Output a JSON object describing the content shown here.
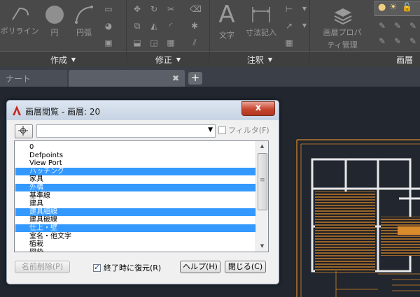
{
  "ribbon": {
    "panels": [
      {
        "footer": "作成",
        "tools": [
          "ポリライン",
          "円",
          "円弧"
        ]
      },
      {
        "footer": "修正"
      },
      {
        "footer": "注釈",
        "tools": [
          "文字",
          "寸法記入"
        ]
      },
      {
        "footer": "画層",
        "tools": [
          "画層プロパティ管理"
        ]
      }
    ]
  },
  "tabs": {
    "start_label": "ナート",
    "close_icon": "close-icon",
    "add_label": "+"
  },
  "dialog": {
    "title": "画層閲覧 - 画層: 20",
    "close_label": "x",
    "combo_value": "",
    "filter_label": "フィルタ(F)",
    "layers": [
      "0",
      "Defpoints",
      "View Port",
      "ハッチング",
      "家具",
      "外構",
      "基準線",
      "建具",
      "建具細線",
      "建具破線",
      "仕上・壁",
      "室名・他文字",
      "植栽",
      "図枠"
    ],
    "selected_layers": [
      "ハッチング",
      "外構",
      "建具細線",
      "仕上・壁"
    ],
    "buttons": {
      "delete_name": "名前削除(P)",
      "restore_on_exit": "終了時に復元(R)",
      "help": "ヘルプ(H)",
      "close": "閉じる(C)"
    },
    "restore_checked": true
  },
  "colors": {
    "drawing_orange": "#d98a2b",
    "selection": "#3399ff",
    "canvas": "#21262f"
  }
}
